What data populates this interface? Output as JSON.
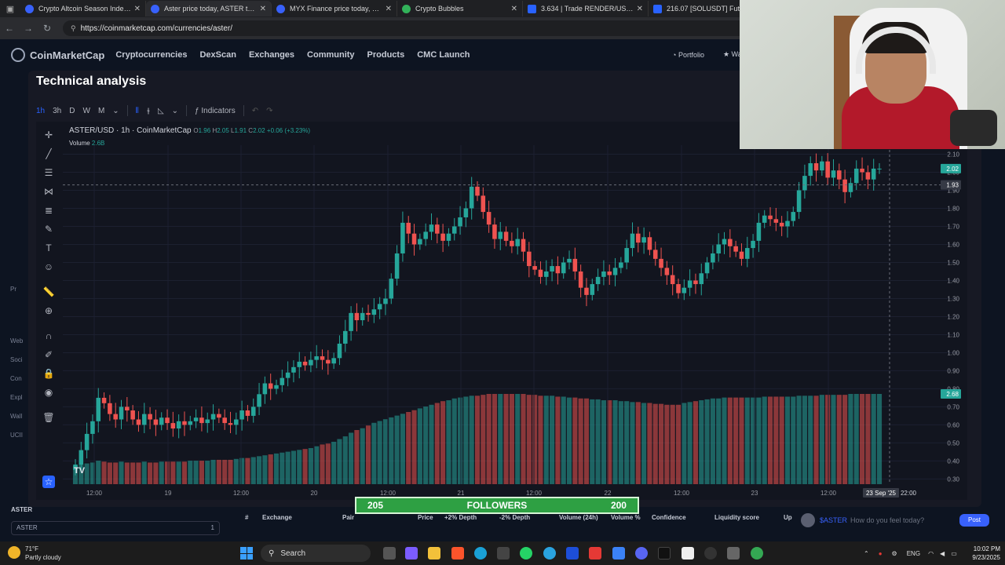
{
  "browser": {
    "tabs": [
      {
        "title": "Crypto Altcoin Season Index | Coi",
        "active": false
      },
      {
        "title": "Aster price today, ASTER to USD l",
        "active": true
      },
      {
        "title": "MYX Finance price today, MYX to",
        "active": false
      },
      {
        "title": "Crypto Bubbles",
        "active": false
      },
      {
        "title": "3.634 | Trade RENDER/USDT Rend",
        "active": false
      },
      {
        "title": "216.07 [SOLUSDT] Futures,",
        "active": false
      }
    ],
    "url": "https://coinmarketcap.com/currencies/aster/"
  },
  "cmc_nav": {
    "logo": "CoinMarketCap",
    "links": [
      "Cryptocurrencies",
      "DexScan",
      "Exchanges",
      "Community",
      "Products",
      "CMC Launch"
    ],
    "portfolio": "Portfolio",
    "watchlist": "Wat"
  },
  "modal": {
    "title": "Technical analysis",
    "toolbar": {
      "intervals": [
        "1h",
        "3h",
        "D",
        "W",
        "M"
      ],
      "active_interval": "1h",
      "indicators": "Indicators"
    }
  },
  "chart_data": {
    "type": "candlestick",
    "symbol": "ASTER/USD · 1h · CoinMarketCap",
    "ohlc_legend": {
      "O": "1.96",
      "H": "2.05",
      "L": "1.91",
      "C": "2.02",
      "change": "+0.06 (+3.23%)"
    },
    "volume_label": "Volume",
    "volume_value": "2.6B",
    "y_ticks": [
      "2.10",
      "2.00",
      "1.90",
      "1.80",
      "1.70",
      "1.60",
      "1.50",
      "1.40",
      "1.30",
      "1.20",
      "1.10",
      "1.00",
      "0.90",
      "0.80",
      "0.70",
      "0.60",
      "0.50",
      "0.40",
      "0.30"
    ],
    "y_range": [
      0.28,
      2.15
    ],
    "x_ticks": [
      "12:00",
      "19",
      "12:00",
      "20",
      "12:00",
      "21",
      "12:00",
      "22",
      "12:00",
      "23",
      "12:00"
    ],
    "crosshair_x_label": "23 Sep '25",
    "crosshair_time": "22:00",
    "last_price_label": "2.02",
    "crosshair_price_label": "1.93",
    "volume_axis_label": "2.68",
    "up_color": "#26a69a",
    "down_color": "#ef5350",
    "closes": [
      0.38,
      0.46,
      0.55,
      0.62,
      0.75,
      0.72,
      0.66,
      0.63,
      0.7,
      0.68,
      0.63,
      0.6,
      0.66,
      0.63,
      0.6,
      0.64,
      0.61,
      0.58,
      0.62,
      0.6,
      0.62,
      0.64,
      0.61,
      0.63,
      0.66,
      0.64,
      0.61,
      0.6,
      0.63,
      0.68,
      0.65,
      0.7,
      0.77,
      0.83,
      0.8,
      0.82,
      0.86,
      0.89,
      0.92,
      0.95,
      0.93,
      0.96,
      0.98,
      0.96,
      0.94,
      0.97,
      1.05,
      1.12,
      1.22,
      1.18,
      1.22,
      1.21,
      1.24,
      1.27,
      1.3,
      1.41,
      1.55,
      1.72,
      1.66,
      1.6,
      1.63,
      1.67,
      1.71,
      1.66,
      1.62,
      1.66,
      1.7,
      1.75,
      1.8,
      1.92,
      1.87,
      1.78,
      1.71,
      1.63,
      1.67,
      1.62,
      1.59,
      1.63,
      1.56,
      1.48,
      1.46,
      1.42,
      1.45,
      1.48,
      1.44,
      1.5,
      1.52,
      1.45,
      1.36,
      1.32,
      1.38,
      1.42,
      1.45,
      1.43,
      1.47,
      1.5,
      1.58,
      1.66,
      1.61,
      1.64,
      1.57,
      1.52,
      1.47,
      1.43,
      1.38,
      1.33,
      1.36,
      1.4,
      1.38,
      1.44,
      1.5,
      1.55,
      1.6,
      1.63,
      1.59,
      1.56,
      1.52,
      1.58,
      1.62,
      1.72,
      1.76,
      1.74,
      1.72,
      1.7,
      1.73,
      1.78,
      1.9,
      1.98,
      2.05,
      2.01,
      2.06,
      1.97,
      2.01,
      1.96,
      1.89,
      1.94,
      2.02,
      2.0,
      1.96,
      2.02,
      2.02
    ],
    "volume_rel": [
      0.2,
      0.22,
      0.23,
      0.24,
      0.26,
      0.25,
      0.24,
      0.24,
      0.25,
      0.24,
      0.24,
      0.24,
      0.25,
      0.24,
      0.24,
      0.25,
      0.25,
      0.25,
      0.25,
      0.25,
      0.26,
      0.26,
      0.26,
      0.26,
      0.27,
      0.27,
      0.27,
      0.27,
      0.28,
      0.29,
      0.29,
      0.3,
      0.31,
      0.32,
      0.33,
      0.34,
      0.35,
      0.36,
      0.37,
      0.38,
      0.39,
      0.4,
      0.42,
      0.44,
      0.45,
      0.47,
      0.5,
      0.53,
      0.57,
      0.6,
      0.62,
      0.65,
      0.68,
      0.7,
      0.72,
      0.74,
      0.76,
      0.78,
      0.8,
      0.82,
      0.84,
      0.86,
      0.88,
      0.9,
      0.92,
      0.93,
      0.95,
      0.96,
      0.97,
      0.98,
      0.98,
      0.99,
      1.0,
      1.0,
      1.0,
      1.0,
      1.0,
      1.0,
      1.0,
      0.99,
      0.99,
      0.98,
      0.98,
      0.98,
      0.97,
      0.97,
      0.96,
      0.96,
      0.95,
      0.95,
      0.94,
      0.94,
      0.93,
      0.93,
      0.93,
      0.92,
      0.92,
      0.91,
      0.91,
      0.9,
      0.9,
      0.89,
      0.89,
      0.88,
      0.88,
      0.88,
      0.9,
      0.91,
      0.92,
      0.93,
      0.94,
      0.95,
      0.95,
      0.96,
      0.96,
      0.96,
      0.96,
      0.96,
      0.96,
      0.96,
      0.97,
      0.97,
      0.97,
      0.97,
      0.97,
      0.97,
      0.98,
      0.98,
      0.98,
      0.98,
      0.99,
      0.99,
      0.99,
      0.99,
      0.99,
      1.0,
      1.0,
      1.0,
      1.0,
      1.0,
      1.0
    ]
  },
  "banner": {
    "left": "205",
    "label": "FOLLOWERS",
    "right": "200"
  },
  "table_header": [
    "#",
    "Exchange",
    "Pair",
    "Price",
    "+2% Depth",
    "-2% Depth",
    "Volume (24h)",
    "Volume %",
    "Confidence",
    "Liquidity score",
    "Up"
  ],
  "bottom_left": {
    "label": "ASTER",
    "box_text": "ASTER",
    "box_num": "1"
  },
  "comment": {
    "tag": "$ASTER",
    "placeholder": "How do you feel today?",
    "post": "Post"
  },
  "left_fragments": [
    "Web",
    "Soci",
    "Con",
    "Expl",
    "Wall",
    "UCII",
    "Pr"
  ],
  "taskbar": {
    "weather_temp": "71°F",
    "weather_desc": "Partly cloudy",
    "search": "Search",
    "lang": "ENG",
    "time": "10:02 PM",
    "date": "9/23/2025"
  }
}
